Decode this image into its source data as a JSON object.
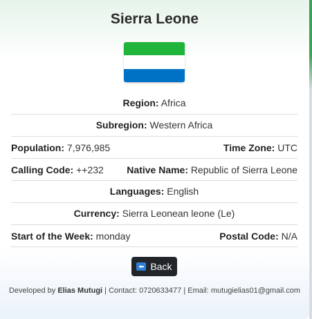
{
  "country": {
    "name": "Sierra Leone",
    "flag_colors": [
      "#1eb53a",
      "#ffffff",
      "#0072c6"
    ]
  },
  "details": {
    "region": {
      "label": "Region:",
      "value": "Africa"
    },
    "subregion": {
      "label": "Subregion:",
      "value": "Western Africa"
    },
    "population": {
      "label": "Population:",
      "value": "7,976,985"
    },
    "timezone": {
      "label": "Time Zone:",
      "value": "UTC"
    },
    "calling_code": {
      "label": "Calling Code:",
      "value": "++232"
    },
    "native_name": {
      "label": "Native Name:",
      "value": "Republic of Sierra Leone"
    },
    "languages": {
      "label": "Languages:",
      "value": "English"
    },
    "currency": {
      "label": "Currency:",
      "value": "Sierra Leonean leone (Le)"
    },
    "start_of_week": {
      "label": "Start of the Week:",
      "value": "monday"
    },
    "postal_code": {
      "label": "Postal Code:",
      "value": "N/A"
    }
  },
  "back_button": {
    "label": "Back",
    "icon": "back-icon"
  },
  "footer": {
    "prefix": "Developed by",
    "developer": "Elias Mutugi",
    "contact": "| Contact: 0720633477 | Email: mutugielias01@gmail.com"
  }
}
